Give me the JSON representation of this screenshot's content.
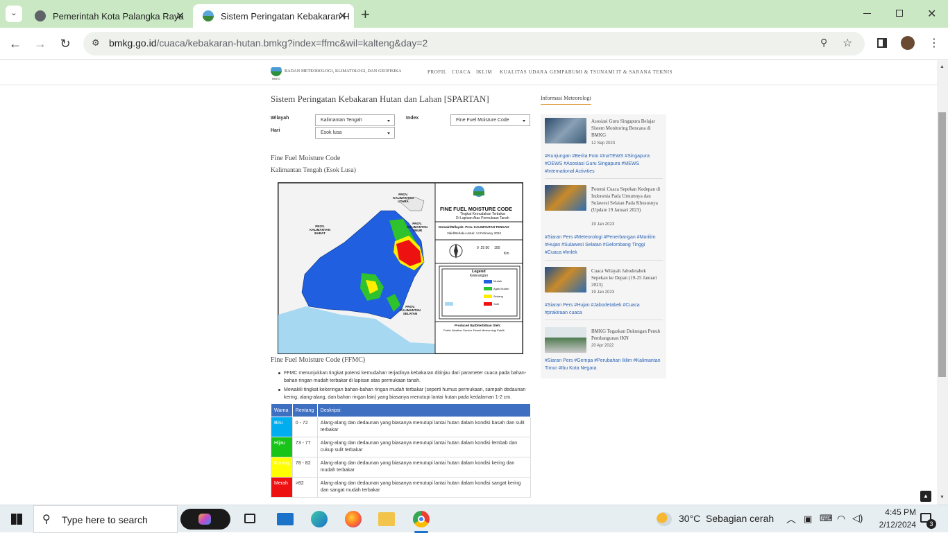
{
  "browser": {
    "tabs": [
      {
        "title": "Pemerintah Kota Palangka Raya",
        "active": false
      },
      {
        "title": "Sistem Peringatan Kebakaran H",
        "active": true
      }
    ],
    "new_tab": "+",
    "url_host": "bmkg.go.id",
    "url_path": "/cuaca/kebakaran-hutan.bmkg?index=ffmc&wil=kalteng&day=2"
  },
  "site": {
    "org_name": "BADAN METEOROLOGI, KLIMATOLOGI, DAN GEOFISIKA",
    "logo_caption": "BMKG",
    "menu": [
      "PROFIL",
      "CUACA",
      "IKLIM",
      "KUALITAS UDARA",
      "GEMPABUMI & TSUNAMI",
      "IT & SARANA TEKNIS"
    ]
  },
  "main": {
    "title": "Sistem Peringatan Kebakaran Hutan dan Lahan [SPARTAN]",
    "wilayah_label": "Wilayah",
    "wilayah_value": "Kalimantan Tengah",
    "index_label": "Index",
    "index_value": "Fine Fuel Moisture Code",
    "hari_label": "Hari",
    "hari_value": "Esok lusa",
    "subtitle": "Fine Fuel Moisture Code",
    "region_line": "Kalimantan Tengah (Esok Lusa)",
    "section_title": "Fine Fuel Moisture Code (FFMC)",
    "bullets": [
      "FFMC menunjukkan tingkat potensi kemudahan terjadinya kebakaran ditinjau dari parameter cuaca pada bahan-bahan ringan mudah terbakar di lapisan atas permukaan tanah.",
      "Mewakili tingkat kekeringan bahan-bahan ringan mudah terbakar (seperti humus permukaan, sampah dedaunan kering, alang-alang, dan bahan ringan lain) yang biasanya menutupi lantai hutan pada kedalaman 1-2 cm."
    ],
    "table": {
      "headers": [
        "Warna",
        "Rentang",
        "Deskripsi"
      ],
      "rows": [
        {
          "warna": "Biru",
          "color": "#00aef0",
          "rentang": "0 - 72",
          "deskripsi": "Alang-alang dan dedaunan yang biasanya menutupi lantai hutan dalam kondisi basah dan sulit terbakar"
        },
        {
          "warna": "Hijau",
          "color": "#19c419",
          "rentang": "73 - 77",
          "deskripsi": "Alang-alang dan dedaunan yang biasanya menutupi lantai hutan dalam kondisi lembab dan cukup sulit terbakar"
        },
        {
          "warna": "Kuning",
          "color": "#ffff00",
          "rentang": "78 - 82",
          "deskripsi": "Alang-alang dan dedaunan yang biasanya menutupi lantai hutan dalam kondisi kering dan mudah terbakar"
        },
        {
          "warna": "Merah",
          "color": "#ee1111",
          "rentang": ">82",
          "deskripsi": "Alang-alang dan dedaunan yang biasanya menutupi lantai hutan dalam kondisi sangat kering dan sangat mudah terbakar"
        }
      ]
    }
  },
  "map": {
    "title": "FINE FUEL MOISTURE CODE",
    "sub1": "Tingkat Kemudahan Terbakar",
    "sub2": "Di Lapisan Atas Permukaan Tanah",
    "domain": "Domain/Wilayah: Prov. KALIMANTAN TENGAH",
    "valid": "Valid/Berlaku untuk: 14 February 2024",
    "scale": "0  25 50     100",
    "scale_unit": "Km",
    "legend_title": "Legend",
    "legend_sub": "Keterangan",
    "legend_items": [
      "Mudah",
      "Agak Mudah",
      "Sedang",
      "Sulit"
    ],
    "produced": "Produced By/Diterbitkan Oleh:",
    "producer": "Public Weather Service Fewsil Meteorologi Publik",
    "provinces": [
      "PROV. KALIMANTAN BARAT",
      "PROV. KALIMANTAN TIMUR",
      "PROV. KALIMANTAN SELATAN",
      "PROV. KALIMANTAN UTARA"
    ]
  },
  "sidebar": {
    "heading": "Informasi Meteorologi",
    "news": [
      {
        "title": "Asosiasi Guru Singapura Belajar Sistem Monitoring Bencana di BMKG",
        "date": "12 Sep 2023",
        "tags": "#Kunjungan #Berita Foto #InaTEWS #Singapura #OEWS #Asosiasi Guru Singapura #MEWS #International Activities"
      },
      {
        "title": "Potensi Cuaca Sepekan Kedepan di Indonesia Pada Umumnya dan Sulawesi Selatan Pada Khususnya (Update 19 Januari 2023)",
        "date": "19 Jan 2023",
        "tags": "#Siaran Pers #Meteorologi #Penerbangan #Maritim #Hujan #Sulawesi Selatan #Gelombang Tinggi #Cuaca #Imlek"
      },
      {
        "title": "Cuaca Wilayah Jabodetabek Sepekan ke Depan (19-25 Januari 2023)",
        "date": "19 Jan 2023",
        "tags": "#Siaran Pers #Hujan #Jabodetabek #Cuaca #prakiraan cuaca"
      },
      {
        "title": "BMKG Tegaskan Dukungan Penuh Pembangunan IKN",
        "date": "20 Apr 2022",
        "tags": "#Siaran Pers #Gempa #Perubahan Iklim #Kalimantan Timur #Ibu Kota Negara"
      }
    ]
  },
  "taskbar": {
    "search_placeholder": "Type here to search",
    "weather": "30°C  Sebagian cerah",
    "time": "4:45 PM",
    "date": "2/12/2024",
    "notif_count": "3"
  }
}
